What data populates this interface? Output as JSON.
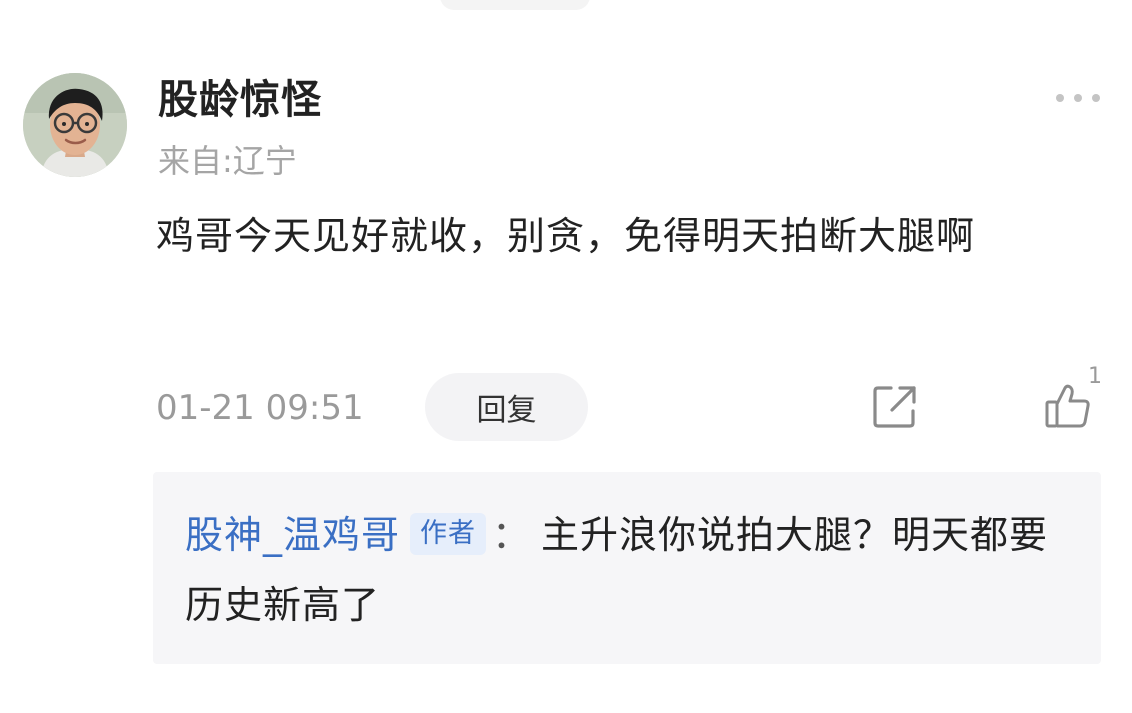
{
  "comment": {
    "username": "股龄惊怪",
    "location": "来自:辽宁",
    "text": "鸡哥今天见好就收，别贪，免得明天拍断大腿啊",
    "timestamp": "01-21 09:51",
    "reply_label": "回复",
    "like_count": "1",
    "icons": {
      "more": "more-dots-icon",
      "share": "share-icon",
      "like": "thumbs-up-icon"
    }
  },
  "reply": {
    "username": "股神_温鸡哥",
    "badge": "作者",
    "separator": "：",
    "text": "主升浪你说拍大腿？明天都要历史新高了"
  },
  "colors": {
    "link_blue": "#3a6fc4",
    "muted_gray": "#9a9a9a",
    "reply_bg": "#f6f6f8"
  }
}
